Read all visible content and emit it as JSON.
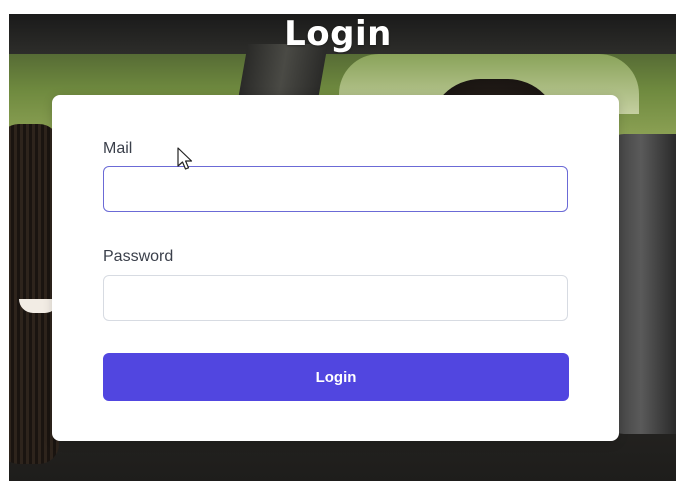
{
  "page": {
    "title": "Login"
  },
  "form": {
    "mail_label": "Mail",
    "mail_value": "",
    "password_label": "Password",
    "password_value": "",
    "submit_label": "Login"
  },
  "colors": {
    "accent": "#5146e0",
    "focus_border": "#6b6ad6",
    "card_background": "#ffffff"
  },
  "icons": {
    "cursor": "mouse-pointer-icon"
  }
}
